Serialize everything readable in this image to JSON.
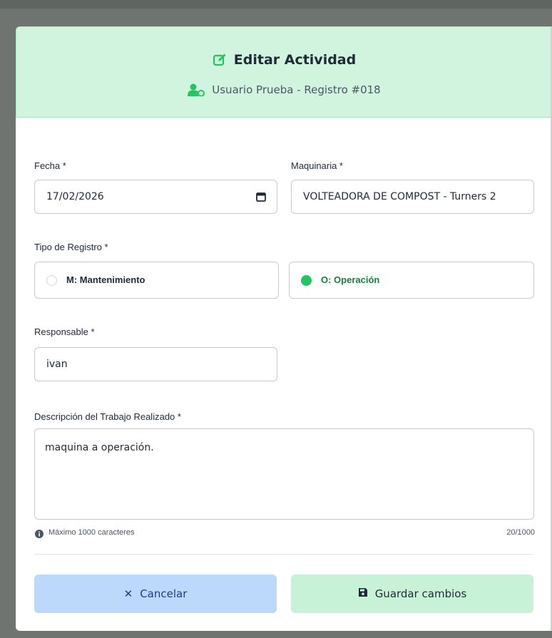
{
  "header": {
    "title": "Editar Actividad",
    "subtitle": "Usuario Prueba - Registro #018",
    "accent_color": "#22c55e",
    "icons": {
      "title": "edit-icon",
      "subtitle": "user-lock-icon"
    }
  },
  "form": {
    "fecha": {
      "label": "Fecha *",
      "value": "17/02/2026"
    },
    "maquinaria": {
      "label": "Maquinaria *",
      "value": "VOLTEADORA DE COMPOST - Turners 2"
    },
    "tipo_registro": {
      "label": "Tipo de Registro *",
      "options": [
        {
          "label": "M: Mantenimiento",
          "selected": false
        },
        {
          "label": "O: Operación",
          "selected": true
        }
      ]
    },
    "responsable": {
      "label": "Responsable *",
      "value": "ivan"
    },
    "descripcion": {
      "label": "Descripción del Trabajo Realizado *",
      "value": "maquina a operación.",
      "hint": "Máximo 1000 caracteres",
      "counter": "20/1000"
    }
  },
  "actions": {
    "cancel_label": "Cancelar",
    "save_label": "Guardar cambios"
  }
}
